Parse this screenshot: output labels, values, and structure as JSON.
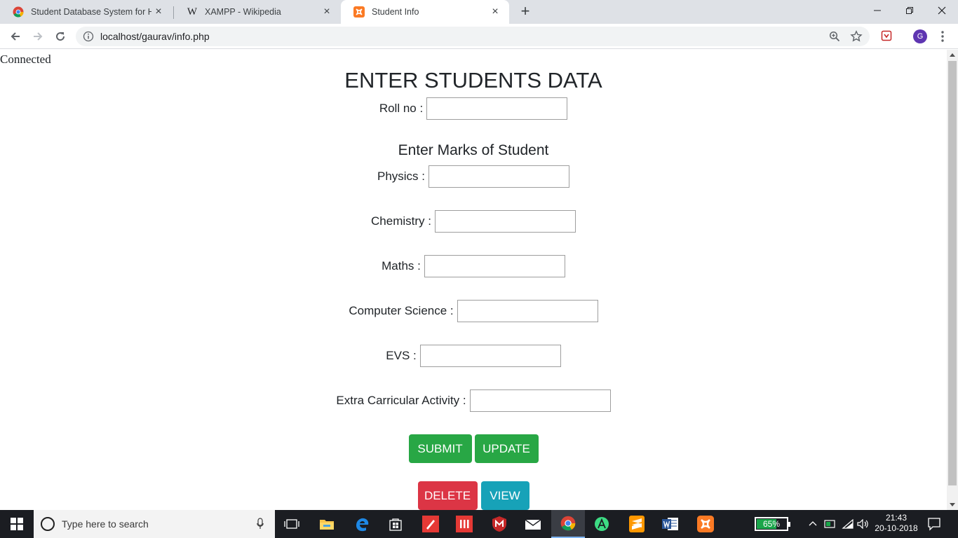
{
  "browser": {
    "tabs": [
      {
        "title": "Student Database System for Hig",
        "active": false
      },
      {
        "title": "XAMPP - Wikipedia",
        "active": false
      },
      {
        "title": "Student Info",
        "active": true
      }
    ],
    "url": "localhost/gaurav/info.php",
    "profile_initial": "G"
  },
  "page": {
    "status": "Connected",
    "title": "ENTER STUDENTS DATA",
    "roll_label": "Roll no :",
    "marks_heading": "Enter Marks of Student",
    "fields": [
      {
        "label": "Physics :",
        "value": ""
      },
      {
        "label": "Chemistry :",
        "value": ""
      },
      {
        "label": "Maths :",
        "value": ""
      },
      {
        "label": "Computer Science :",
        "value": ""
      },
      {
        "label": "EVS :",
        "value": ""
      },
      {
        "label": "Extra Carricular Activity :",
        "value": ""
      }
    ],
    "buttons": {
      "submit": "SUBMIT",
      "update": "UPDATE",
      "delete": "DELETE",
      "view": "VIEW"
    },
    "colors": {
      "green": "#28a745",
      "red": "#dc3545",
      "cyan": "#17a2b8"
    }
  },
  "taskbar": {
    "search_placeholder": "Type here to search",
    "battery_percent": "65%",
    "time": "21:43",
    "date": "20-10-2018"
  }
}
